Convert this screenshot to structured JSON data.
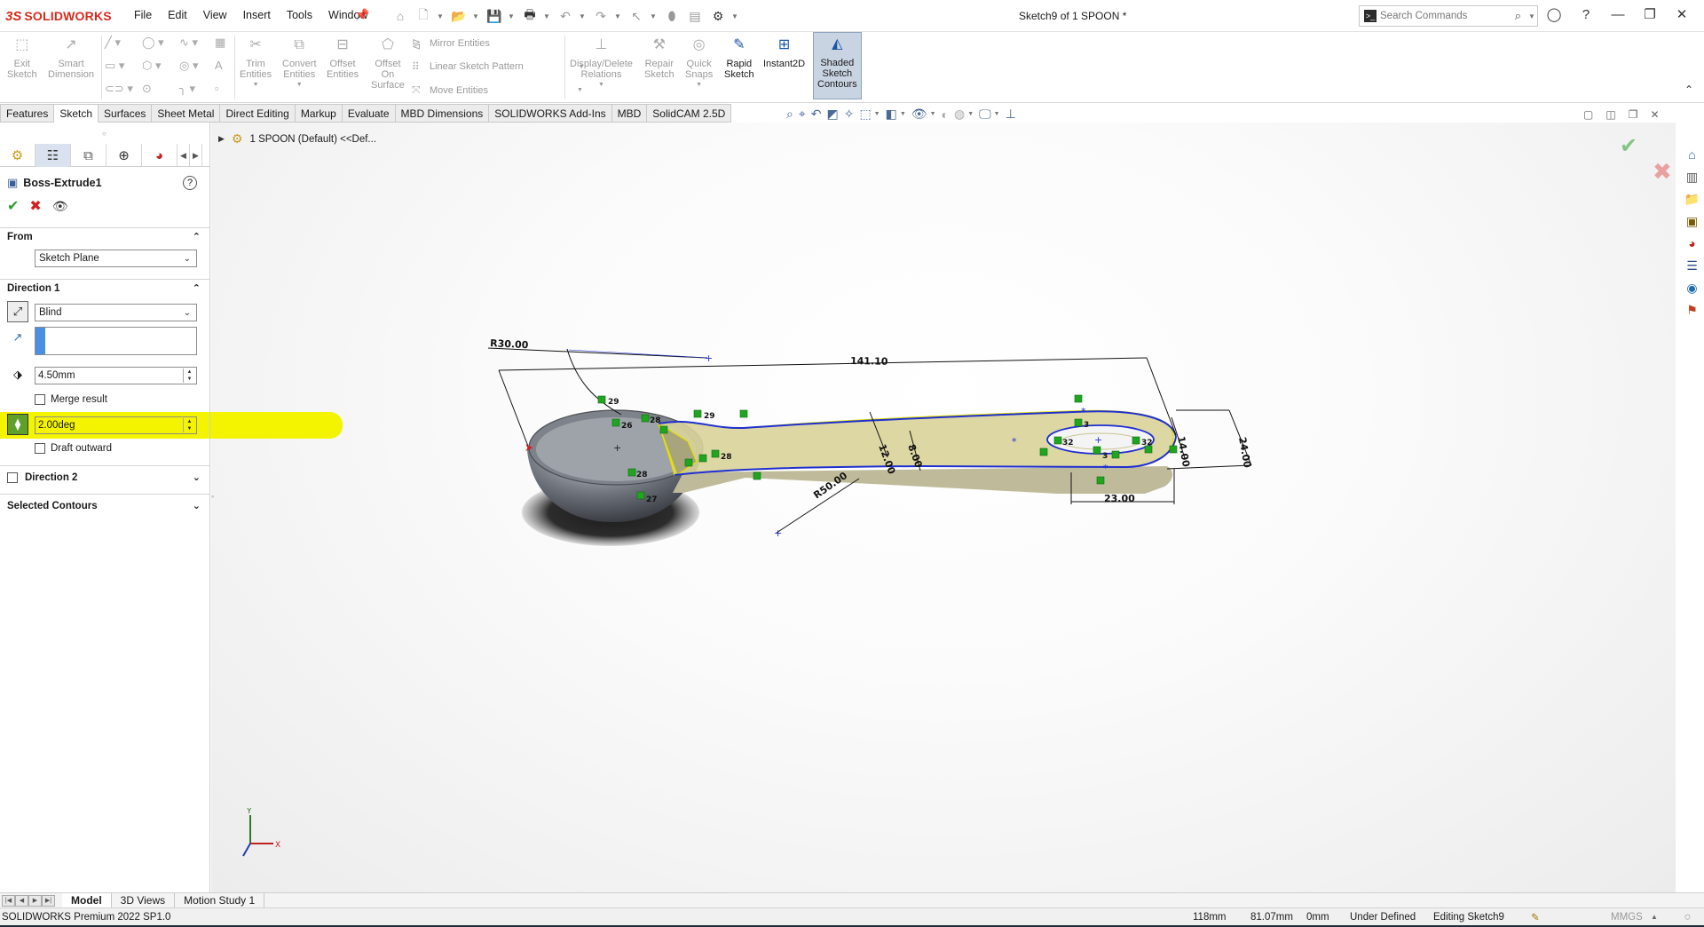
{
  "app": {
    "logo_mark": "3S",
    "logo_text": "SOLIDWORKS",
    "doc_title": "Sketch9 of 1 SPOON *"
  },
  "menu": [
    "File",
    "Edit",
    "View",
    "Insert",
    "Tools",
    "Window"
  ],
  "search": {
    "placeholder": "Search Commands"
  },
  "command_manager": {
    "exit_sketch": [
      "Exit",
      "Sketch"
    ],
    "smart_dimension": [
      "Smart",
      "Dimension"
    ],
    "trim_entities": [
      "Trim",
      "Entities"
    ],
    "convert_entities": [
      "Convert",
      "Entities"
    ],
    "offset_entities": [
      "Offset",
      "Entities"
    ],
    "offset_on_surface": [
      "Offset",
      "On",
      "Surface"
    ],
    "mirror_entities": "Mirror Entities",
    "linear_sketch_pattern": "Linear Sketch Pattern",
    "move_entities": "Move Entities",
    "display_delete_relations": [
      "Display/Delete",
      "Relations"
    ],
    "repair_sketch": [
      "Repair",
      "Sketch"
    ],
    "quick_snaps": [
      "Quick",
      "Snaps"
    ],
    "rapid_sketch": [
      "Rapid",
      "Sketch"
    ],
    "instant2d": "Instant2D",
    "shaded_sketch_contours": [
      "Shaded",
      "Sketch",
      "Contours"
    ]
  },
  "tabs": [
    "Features",
    "Sketch",
    "Surfaces",
    "Sheet Metal",
    "Direct Editing",
    "Markup",
    "Evaluate",
    "MBD Dimensions",
    "SOLIDWORKS Add-Ins",
    "MBD",
    "SolidCAM 2.5D"
  ],
  "active_tab": "Sketch",
  "feature_tree": {
    "item": "1 SPOON  (Default) <<Def..."
  },
  "property_manager": {
    "title": "Boss-Extrude1",
    "from": {
      "label": "From",
      "value": "Sketch Plane"
    },
    "direction1": {
      "label": "Direction 1",
      "end_condition": "Blind",
      "depth": "4.50mm",
      "merge_result": "Merge result",
      "draft_angle": "2.00deg",
      "draft_outward": "Draft outward"
    },
    "direction2": {
      "label": "Direction 2"
    },
    "selected_contours": {
      "label": "Selected Contours"
    }
  },
  "sketch_dimensions": {
    "radius": "R30.00",
    "overall_length": "141.10",
    "handle_width_a": "12.00",
    "handle_width_b": "8.00",
    "fillet_radius": "R50.00",
    "hole_width": "23.00",
    "end_width": "24.00",
    "end_small": "14.00"
  },
  "relation_labels": [
    "29",
    "26",
    "28",
    "28",
    "27",
    "29",
    "28",
    "32",
    "32",
    "3",
    "3"
  ],
  "triad": {
    "x": "X",
    "y": "Y"
  },
  "bottom_tabs": [
    "Model",
    "3D Views",
    "Motion Study 1"
  ],
  "active_bottom_tab": "Model",
  "status": {
    "product": "SOLIDWORKS Premium 2022 SP1.0",
    "x": "118mm",
    "y": "81.07mm",
    "z": "0mm",
    "state": "Under Defined",
    "editing": "Editing Sketch9",
    "units": "MMGS"
  },
  "colors": {
    "brand": "#d52b1e",
    "highlight": "#f4f400",
    "sketch_blue": "#1f2fd1",
    "relation_green": "#1fa51f"
  }
}
